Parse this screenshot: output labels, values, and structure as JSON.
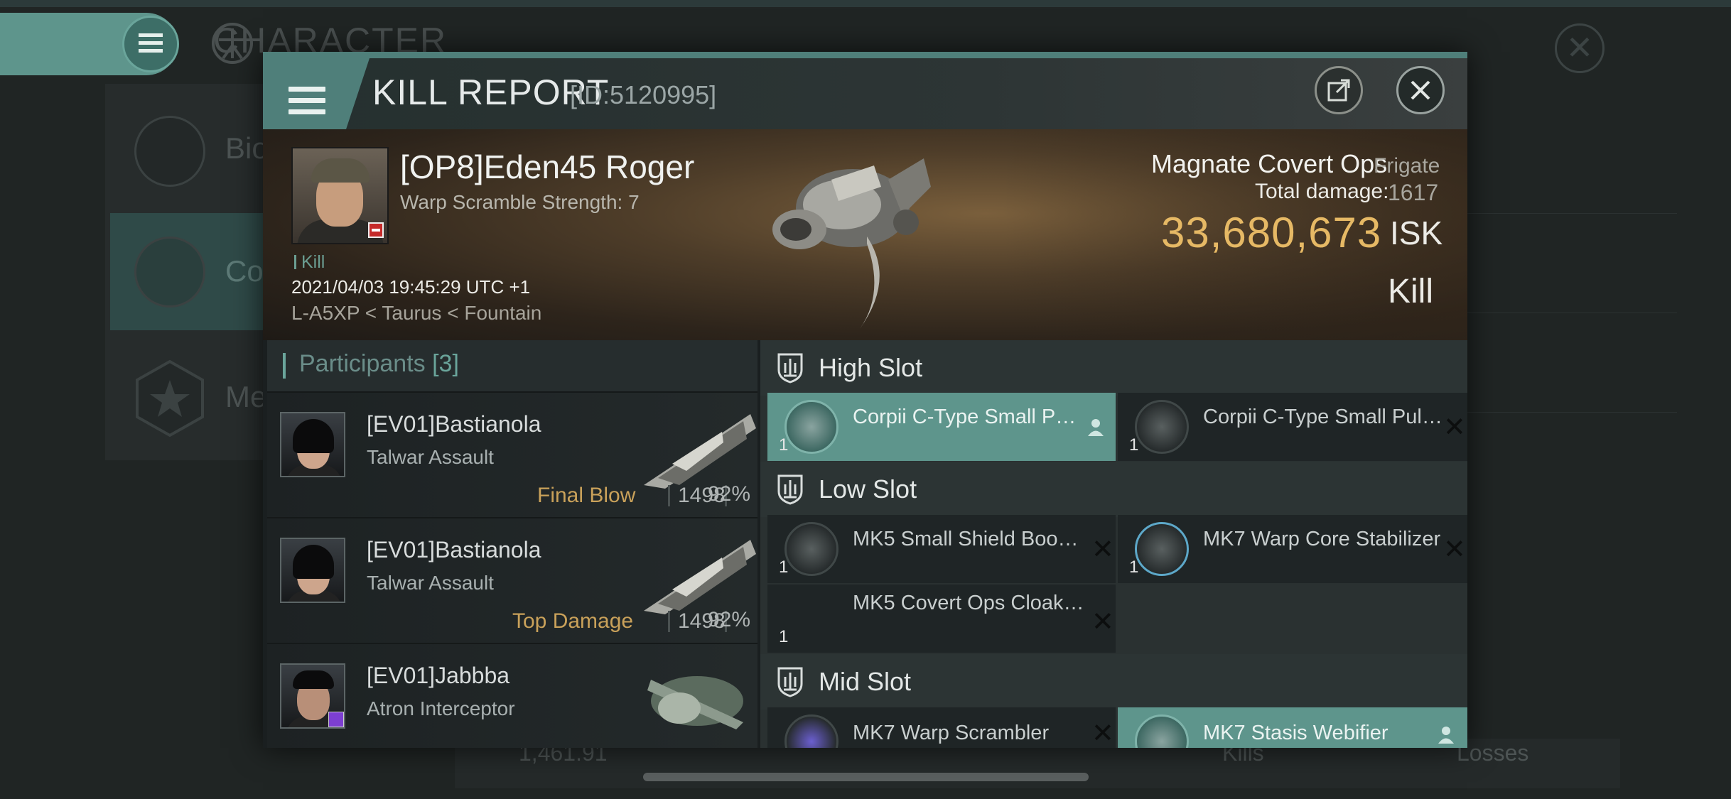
{
  "background": {
    "title": "CHARACTER",
    "left_items": [
      "Bio",
      "Co",
      "Me"
    ],
    "bottom_value": "1,461.91",
    "bottom_kills": "Kills",
    "bottom_losses": "Losses"
  },
  "dialog": {
    "title": "KILL REPORT",
    "id": "[ID:5120995]",
    "external_icon": "external-link-icon",
    "close_icon": "close-icon"
  },
  "victim": {
    "name": "[OP8]Eden45 Roger",
    "warp_scramble": "Warp Scramble Strength: 7",
    "tag": "Kill",
    "datetime": "2021/04/03 19:45:29 UTC +1",
    "location": "L-A5XP < Taurus < Fountain",
    "ship_name": "Magnate Covert Ops",
    "ship_class": "Frigate",
    "total_damage_label": "Total damage:",
    "total_damage": "1617",
    "isk_value": "33,680,673",
    "isk_unit": "ISK",
    "report_type": "Kill"
  },
  "participants": {
    "label": "Participants",
    "count": "[3]",
    "rows": [
      {
        "name": "[EV01]Bastianola",
        "ship": "Talwar Assault",
        "tag": "Final Blow",
        "damage": "1498",
        "percent": "92%"
      },
      {
        "name": "[EV01]Bastianola",
        "ship": "Talwar Assault",
        "tag": "Top Damage",
        "damage": "1498",
        "percent": "92%"
      },
      {
        "name": "[EV01]Jabbba",
        "ship": "Atron Interceptor",
        "tag": "",
        "damage": "",
        "percent": ""
      }
    ]
  },
  "slots": {
    "high": {
      "label": "High Slot",
      "modules": [
        {
          "name": "Corpii C-Type Small Pulse...",
          "qty": "1",
          "status": "person",
          "highlighted": true
        },
        {
          "name": "Corpii C-Type Small Pulse...",
          "qty": "1",
          "status": "destroyed",
          "highlighted": false
        }
      ]
    },
    "low": {
      "label": "Low Slot",
      "modules": [
        {
          "name": "MK5 Small Shield Booster",
          "qty": "1",
          "status": "destroyed"
        },
        {
          "name": "MK7 Warp Core Stabilizer",
          "qty": "1",
          "status": "destroyed"
        },
        {
          "name": "MK5 Covert Ops Cloaking...",
          "qty": "1",
          "status": "destroyed"
        }
      ]
    },
    "mid": {
      "label": "Mid Slot",
      "modules": [
        {
          "name": "MK7 Warp Scrambler",
          "status": "destroyed"
        },
        {
          "name": "MK7 Stasis Webifier",
          "status": "person",
          "highlighted": true
        }
      ]
    }
  },
  "colors": {
    "accent": "#5e958c",
    "isk_gold": "#e6b965",
    "final_blow": "#c9a15a"
  }
}
